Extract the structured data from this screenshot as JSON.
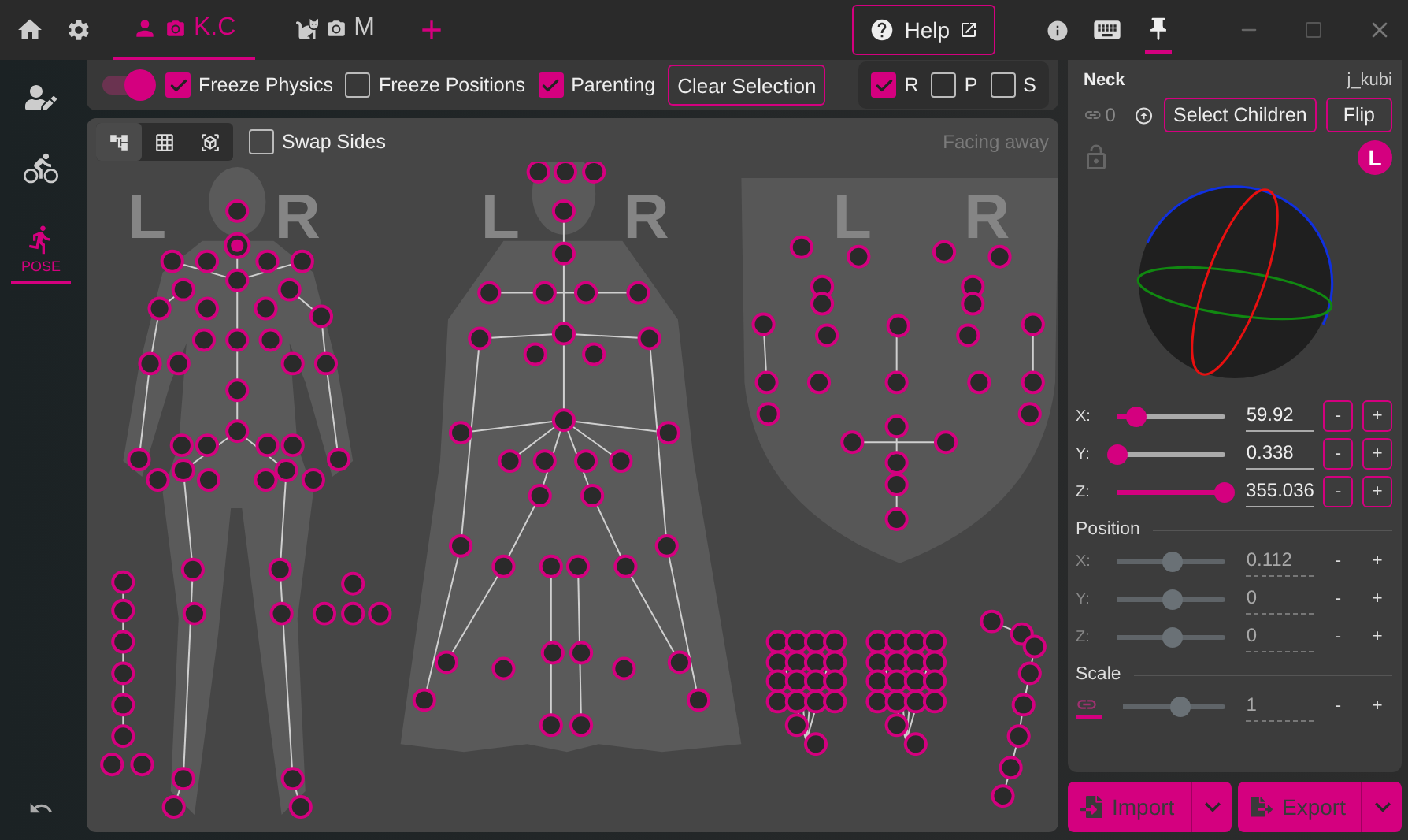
{
  "top_bar": {
    "tabs": [
      {
        "kind": "character",
        "label": "K.C",
        "selected": true
      },
      {
        "kind": "pet",
        "label": "M",
        "selected": false
      }
    ],
    "help": "Help",
    "pinned": true
  },
  "sidebar": {
    "items": [
      {
        "kind": "character",
        "selected": false
      },
      {
        "kind": "motion",
        "selected": false
      },
      {
        "kind": "pose",
        "label": "POSE",
        "selected": true
      }
    ]
  },
  "toolbar": {
    "physics_toggle": {
      "on": true
    },
    "checkboxes": [
      {
        "label": "Freeze Physics",
        "checked": true
      },
      {
        "label": "Freeze Positions",
        "checked": false
      },
      {
        "label": "Parenting",
        "checked": true
      }
    ],
    "clear_button": "Clear Selection",
    "transform_filters": [
      {
        "label": "R",
        "checked": true
      },
      {
        "label": "P",
        "checked": false
      },
      {
        "label": "S",
        "checked": false
      }
    ]
  },
  "canvas": {
    "view_modes": [
      {
        "kind": "skeleton",
        "selected": true
      },
      {
        "kind": "grid",
        "selected": false
      },
      {
        "kind": "cube",
        "selected": false
      }
    ],
    "swap_sides": {
      "label": "Swap Sides",
      "checked": false
    },
    "facing": "Facing away",
    "side_labels": [
      "L",
      "R",
      "L",
      "R",
      "L",
      "R"
    ]
  },
  "bone_panel": {
    "name": "Neck",
    "id": "j_kubi",
    "link_count": "0",
    "buttons": [
      "Select Children",
      "Flip"
    ],
    "locked": false,
    "space_badge": "L",
    "rotation": [
      {
        "axis": "X:",
        "value": "59.92",
        "level": 0.17,
        "minus": "-",
        "plus": "+"
      },
      {
        "axis": "Y:",
        "value": "0.338",
        "level": 0.0,
        "minus": "-",
        "plus": "+"
      },
      {
        "axis": "Z:",
        "value": "355.036",
        "level": 0.99,
        "minus": "-",
        "plus": "+"
      }
    ],
    "position": {
      "title": "Position",
      "sliders": [
        {
          "axis": "X:",
          "value": "0.112",
          "level": 0.5,
          "minus": "-",
          "plus": "+"
        },
        {
          "axis": "Y:",
          "value": "0",
          "level": 0.5,
          "minus": "-",
          "plus": "+"
        },
        {
          "axis": "Z:",
          "value": "0",
          "level": 0.5,
          "minus": "-",
          "plus": "+"
        }
      ]
    },
    "scale": {
      "title": "Scale",
      "linked": true,
      "value": "1",
      "level": 0.55,
      "minus": "-",
      "plus": "+"
    }
  },
  "actions": [
    {
      "kind": "import",
      "label": "Import"
    },
    {
      "kind": "export",
      "label": "Export"
    }
  ]
}
